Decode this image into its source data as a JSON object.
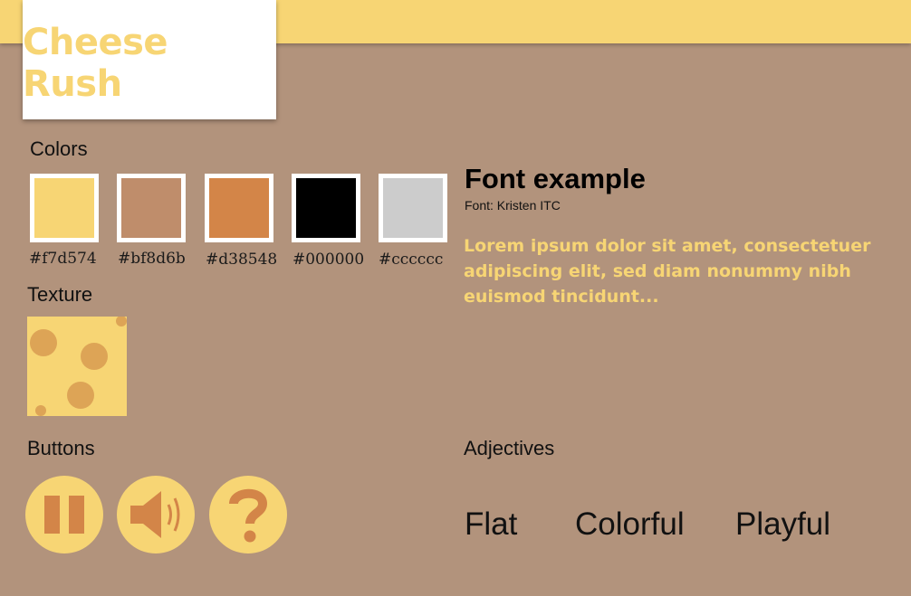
{
  "header": {
    "logo": "Cheese Rush"
  },
  "colors": {
    "label": "Colors",
    "swatches": [
      {
        "hex": "#f7d574",
        "label": "#f7d574"
      },
      {
        "hex": "#bf8d6b",
        "label": "#bf8d6b"
      },
      {
        "hex": "#d38548",
        "label": "#d38548"
      },
      {
        "hex": "#000000",
        "label": "#000000"
      },
      {
        "hex": "#cccccc",
        "label": "#cccccc"
      }
    ]
  },
  "font_example": {
    "title": "Font example",
    "font_name": "Font: Kristen ITC",
    "sample": "Lorem ipsum dolor sit amet, consectetuer adipiscing elit, sed diam nonummy nibh euismod tincidunt..."
  },
  "texture": {
    "label": "Texture",
    "icon": "cheese-texture",
    "colors": {
      "base": "#f7d574",
      "holes": "#dda456"
    }
  },
  "buttons": {
    "label": "Buttons",
    "items": [
      {
        "icon": "pause-icon"
      },
      {
        "icon": "speaker-icon"
      },
      {
        "icon": "question-icon"
      }
    ]
  },
  "adjectives": {
    "label": "Adjectives",
    "items": [
      "Flat",
      "Colorful",
      "Playful"
    ]
  }
}
